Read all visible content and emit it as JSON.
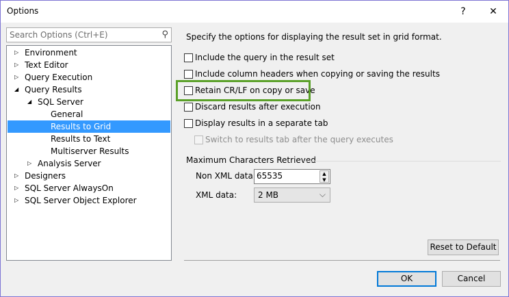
{
  "window": {
    "title": "Options",
    "help": "?",
    "close": "✕"
  },
  "search": {
    "placeholder": "Search Options (Ctrl+E)"
  },
  "tree": [
    {
      "label": "Environment",
      "arrow": "▷"
    },
    {
      "label": "Text Editor",
      "arrow": "▷"
    },
    {
      "label": "Query Execution",
      "arrow": "▷"
    },
    {
      "label": "Query Results",
      "arrow": "◢"
    },
    {
      "label": "SQL Server",
      "arrow": "◢"
    },
    {
      "label": "General"
    },
    {
      "label": "Results to Grid",
      "selected": true
    },
    {
      "label": "Results to Text"
    },
    {
      "label": "Multiserver Results"
    },
    {
      "label": "Analysis Server",
      "arrow": "▷"
    },
    {
      "label": "Designers",
      "arrow": "▷"
    },
    {
      "label": "SQL Server AlwaysOn",
      "arrow": "▷"
    },
    {
      "label": "SQL Server Object Explorer",
      "arrow": "▷"
    }
  ],
  "main": {
    "description": "Specify the options for displaying the result set in grid format.",
    "checkboxes": [
      {
        "label": "Include the query in the result set",
        "checked": false
      },
      {
        "label": "Include column headers when copying or saving the results",
        "checked": false
      },
      {
        "label": "Retain CR/LF on copy or save",
        "checked": false
      },
      {
        "label": "Discard results after execution",
        "checked": false
      },
      {
        "label": "Display results in a separate tab",
        "checked": false
      },
      {
        "label": "Switch to results tab after the query executes",
        "checked": false,
        "disabled": true
      }
    ],
    "group_label": "Maximum Characters Retrieved",
    "non_xml_label": "Non XML data:",
    "non_xml_value": "65535",
    "xml_label": "XML data:",
    "xml_value": "2 MB",
    "reset_label": "Reset to Default"
  },
  "footer": {
    "ok": "OK",
    "cancel": "Cancel"
  },
  "colors": {
    "highlight": "#5aa028",
    "selection": "#3399ff"
  }
}
